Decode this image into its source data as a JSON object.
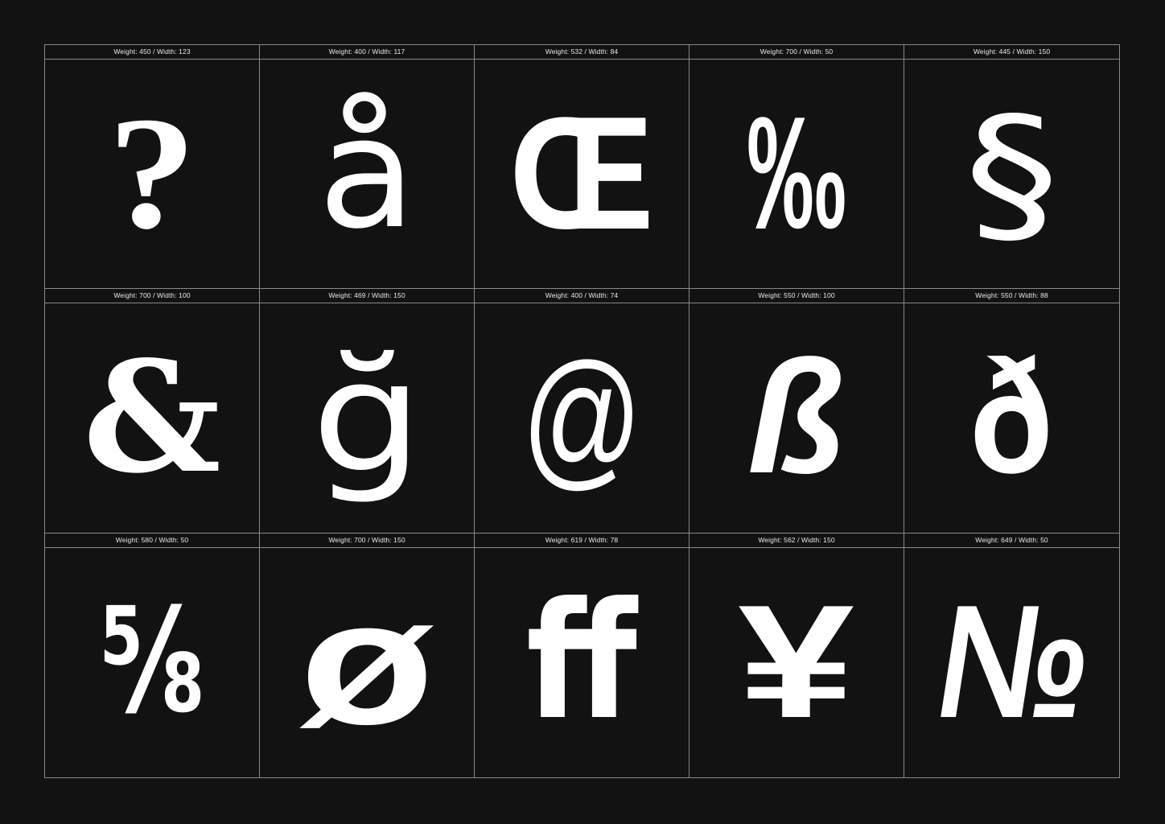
{
  "specimens": [
    {
      "label": "Weight: 450 / Width: 123",
      "glyph": "?"
    },
    {
      "label": "Weight: 400 / Width: 117",
      "glyph": "å"
    },
    {
      "label": "Weight: 532 / Width: 84",
      "glyph": "Œ"
    },
    {
      "label": "Weight: 700 / Width: 50",
      "glyph": "‰"
    },
    {
      "label": "Weight: 445 / Width: 150",
      "glyph": "§"
    },
    {
      "label": "Weight: 700 / Width: 100",
      "glyph": "&"
    },
    {
      "label": "Weight: 469 / Width: 150",
      "glyph": "ğ"
    },
    {
      "label": "Weight: 400 / Width: 74",
      "glyph": "@"
    },
    {
      "label": "Weight: 550 / Width: 100",
      "glyph": "ß"
    },
    {
      "label": "Weight: 550 / Width: 88",
      "glyph": "ð"
    },
    {
      "label": "Weight: 580 / Width: 50",
      "glyph": "⅝"
    },
    {
      "label": "Weight: 700 / Width: 150",
      "glyph": "ø"
    },
    {
      "label": "Weight: 619 / Width: 78",
      "glyph": "ﬀ"
    },
    {
      "label": "Weight: 562 / Width: 150",
      "glyph": "¥"
    },
    {
      "label": "Weight: 649 / Width: 50",
      "glyph": "№"
    }
  ],
  "colors": {
    "background": "#121212",
    "grid_lines": "#8a8a8a",
    "glyph": "#ffffff",
    "label_text": "#e9e9e9"
  }
}
